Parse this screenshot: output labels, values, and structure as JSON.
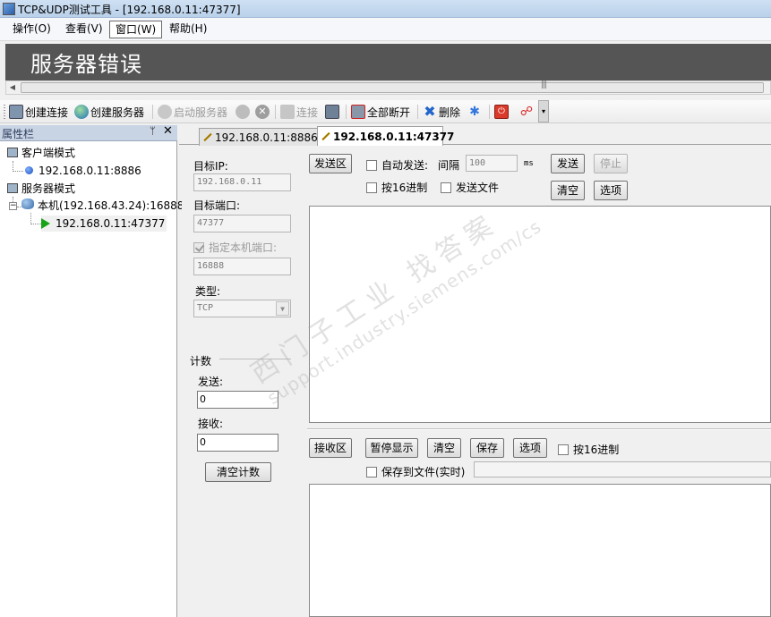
{
  "window": {
    "title": "TCP&UDP测试工具 - [192.168.0.11:47377]"
  },
  "menu": {
    "items": [
      {
        "label": "操作(O)"
      },
      {
        "label": "查看(V)"
      },
      {
        "label": "窗口(W)"
      },
      {
        "label": "帮助(H)"
      }
    ],
    "active_index": 2
  },
  "banner": {
    "title": "服务器错误"
  },
  "toolbar": {
    "create_connection": "创建连接",
    "create_server": "创建服务器",
    "start_server": "启动服务器",
    "connect": "连接",
    "disconnect_all": "全部断开",
    "delete": "删除"
  },
  "left_panel": {
    "title": "属性栏",
    "pin": "ᛘ",
    "close": "✕",
    "tree": {
      "client_mode": "客户端模式",
      "client_item": "192.168.0.11:8886",
      "server_mode": "服务器模式",
      "local_host": "本机(192.168.43.24):16888",
      "server_item": "192.168.0.11:47377"
    }
  },
  "tabs": [
    {
      "label": "192.168.0.11:8886"
    },
    {
      "label": "192.168.0.11:47377"
    }
  ],
  "settings": {
    "target_ip_label": "目标IP:",
    "target_ip": "192.168.0.11",
    "target_port_label": "目标端口:",
    "target_port": "47377",
    "local_port_label": "指定本机端口:",
    "local_port": "16888",
    "type_label": "类型:",
    "type_value": "TCP"
  },
  "counter": {
    "title": "计数",
    "send_label": "发送:",
    "send_value": "0",
    "recv_label": "接收:",
    "recv_value": "0",
    "clear_button": "清空计数"
  },
  "send": {
    "area_button": "发送区",
    "auto_send": "自动发送:",
    "interval_label": "间隔",
    "interval_value": "100",
    "interval_unit": "ms",
    "send_button": "发送",
    "stop_button": "停止",
    "hex_send": "按16进制",
    "send_file": "发送文件",
    "clear_button": "清空",
    "options_button": "选项"
  },
  "receive": {
    "area_button": "接收区",
    "pause_button": "暂停显示",
    "clear_button": "清空",
    "save_button": "保存",
    "options_button": "选项",
    "hex_recv": "按16进制",
    "save_to_file": "保存到文件(实时)"
  },
  "watermark": {
    "line1": "西门子工业 找答案",
    "line2": "support.industry.siemens.com/cs"
  },
  "colors": {
    "banner_bg": "#555555",
    "panel_header": "#c8d3e3",
    "tab_diamond": "#f2c300",
    "play_green": "#16a316"
  }
}
